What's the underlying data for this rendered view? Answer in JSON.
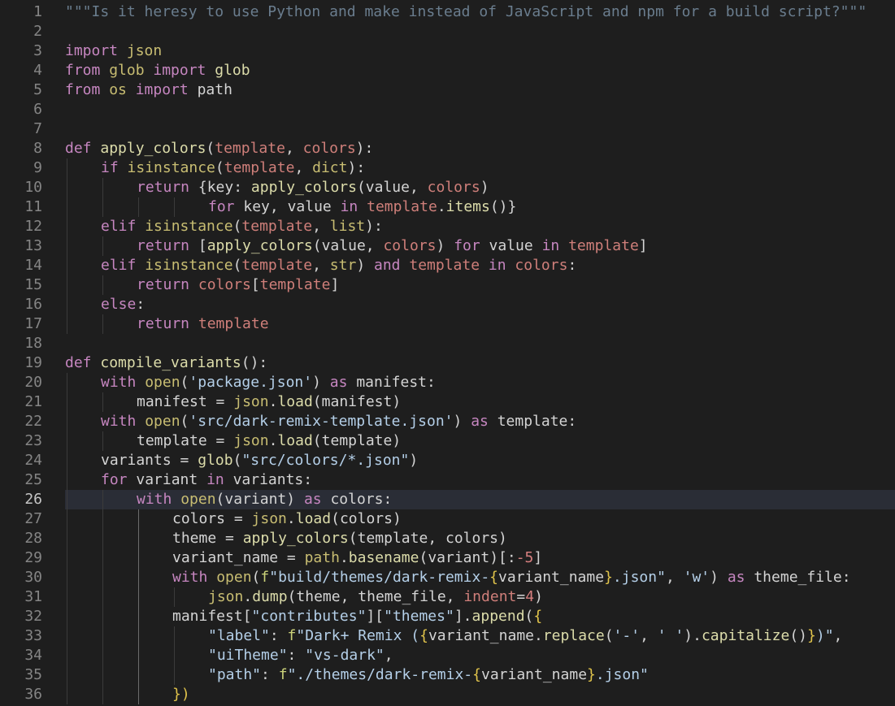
{
  "editor": {
    "active_line": 26,
    "lines": [
      {
        "n": "1",
        "indent": 0,
        "tokens": [
          [
            "\"\"\"Is it heresy to use Python and make instead of JavaScript and npm for a build script?\"\"\"",
            "comment"
          ]
        ]
      },
      {
        "n": "2",
        "indent": 0,
        "tokens": []
      },
      {
        "n": "3",
        "indent": 0,
        "tokens": [
          [
            "import ",
            "keyword"
          ],
          [
            "json",
            "builtin"
          ]
        ]
      },
      {
        "n": "4",
        "indent": 0,
        "tokens": [
          [
            "from ",
            "keyword"
          ],
          [
            "glob ",
            "builtin"
          ],
          [
            "import ",
            "keyword"
          ],
          [
            "glob",
            "function"
          ]
        ]
      },
      {
        "n": "5",
        "indent": 0,
        "tokens": [
          [
            "from ",
            "keyword"
          ],
          [
            "os ",
            "builtin"
          ],
          [
            "import ",
            "keyword"
          ],
          [
            "path",
            "default"
          ]
        ]
      },
      {
        "n": "6",
        "indent": 0,
        "tokens": []
      },
      {
        "n": "7",
        "indent": 0,
        "tokens": []
      },
      {
        "n": "8",
        "indent": 0,
        "tokens": [
          [
            "def ",
            "keyword"
          ],
          [
            "apply_colors",
            "function"
          ],
          [
            "(",
            "paren"
          ],
          [
            "template",
            "param"
          ],
          [
            ", ",
            "default"
          ],
          [
            "colors",
            "param"
          ],
          [
            "):",
            "paren"
          ]
        ]
      },
      {
        "n": "9",
        "indent": 1,
        "tokens": [
          [
            "if ",
            "keyword"
          ],
          [
            "isinstance",
            "builtin"
          ],
          [
            "(",
            "paren"
          ],
          [
            "template",
            "param"
          ],
          [
            ", ",
            "default"
          ],
          [
            "dict",
            "builtin"
          ],
          [
            "):",
            "paren"
          ]
        ]
      },
      {
        "n": "10",
        "indent": 2,
        "tokens": [
          [
            "return ",
            "keyword"
          ],
          [
            "{",
            "paren"
          ],
          [
            "key",
            "default"
          ],
          [
            ": ",
            "default"
          ],
          [
            "apply_colors",
            "function"
          ],
          [
            "(",
            "paren"
          ],
          [
            "value",
            "default"
          ],
          [
            ", ",
            "default"
          ],
          [
            "colors",
            "param"
          ],
          [
            ")",
            "paren"
          ]
        ]
      },
      {
        "n": "11",
        "indent": 4,
        "tokens": [
          [
            "for ",
            "keyword"
          ],
          [
            "key",
            "default"
          ],
          [
            ", ",
            "default"
          ],
          [
            "value ",
            "default"
          ],
          [
            "in ",
            "keyword"
          ],
          [
            "template",
            "param"
          ],
          [
            ".",
            "default"
          ],
          [
            "items",
            "function"
          ],
          [
            "()}",
            "paren"
          ]
        ]
      },
      {
        "n": "12",
        "indent": 1,
        "tokens": [
          [
            "elif ",
            "keyword"
          ],
          [
            "isinstance",
            "builtin"
          ],
          [
            "(",
            "paren"
          ],
          [
            "template",
            "param"
          ],
          [
            ", ",
            "default"
          ],
          [
            "list",
            "builtin"
          ],
          [
            "):",
            "paren"
          ]
        ]
      },
      {
        "n": "13",
        "indent": 2,
        "tokens": [
          [
            "return ",
            "keyword"
          ],
          [
            "[",
            "paren"
          ],
          [
            "apply_colors",
            "function"
          ],
          [
            "(",
            "paren"
          ],
          [
            "value",
            "default"
          ],
          [
            ", ",
            "default"
          ],
          [
            "colors",
            "param"
          ],
          [
            ") ",
            "paren"
          ],
          [
            "for ",
            "keyword"
          ],
          [
            "value ",
            "default"
          ],
          [
            "in ",
            "keyword"
          ],
          [
            "template",
            "param"
          ],
          [
            "]",
            "paren"
          ]
        ]
      },
      {
        "n": "14",
        "indent": 1,
        "tokens": [
          [
            "elif ",
            "keyword"
          ],
          [
            "isinstance",
            "builtin"
          ],
          [
            "(",
            "paren"
          ],
          [
            "template",
            "param"
          ],
          [
            ", ",
            "default"
          ],
          [
            "str",
            "builtin"
          ],
          [
            ") ",
            "paren"
          ],
          [
            "and ",
            "keyword"
          ],
          [
            "template ",
            "param"
          ],
          [
            "in ",
            "keyword"
          ],
          [
            "colors",
            "param"
          ],
          [
            ":",
            "default"
          ]
        ]
      },
      {
        "n": "15",
        "indent": 2,
        "tokens": [
          [
            "return ",
            "keyword"
          ],
          [
            "colors",
            "param"
          ],
          [
            "[",
            "paren"
          ],
          [
            "template",
            "param"
          ],
          [
            "]",
            "paren"
          ]
        ]
      },
      {
        "n": "16",
        "indent": 1,
        "tokens": [
          [
            "else",
            "keyword"
          ],
          [
            ":",
            "default"
          ]
        ]
      },
      {
        "n": "17",
        "indent": 2,
        "tokens": [
          [
            "return ",
            "keyword"
          ],
          [
            "template",
            "param"
          ]
        ]
      },
      {
        "n": "18",
        "indent": 0,
        "tokens": []
      },
      {
        "n": "19",
        "indent": 0,
        "tokens": [
          [
            "def ",
            "keyword"
          ],
          [
            "compile_variants",
            "function"
          ],
          [
            "():",
            "paren"
          ]
        ]
      },
      {
        "n": "20",
        "indent": 1,
        "tokens": [
          [
            "with ",
            "keyword"
          ],
          [
            "open",
            "builtin"
          ],
          [
            "(",
            "paren"
          ],
          [
            "'package.json'",
            "string"
          ],
          [
            ") ",
            "paren"
          ],
          [
            "as ",
            "keyword"
          ],
          [
            "manifest",
            "default"
          ],
          [
            ":",
            "default"
          ]
        ]
      },
      {
        "n": "21",
        "indent": 2,
        "tokens": [
          [
            "manifest ",
            "default"
          ],
          [
            "= ",
            "default"
          ],
          [
            "json",
            "builtin"
          ],
          [
            ".",
            "default"
          ],
          [
            "load",
            "function"
          ],
          [
            "(",
            "paren"
          ],
          [
            "manifest",
            "default"
          ],
          [
            ")",
            "paren"
          ]
        ]
      },
      {
        "n": "22",
        "indent": 1,
        "tokens": [
          [
            "with ",
            "keyword"
          ],
          [
            "open",
            "builtin"
          ],
          [
            "(",
            "paren"
          ],
          [
            "'src/dark-remix-template.json'",
            "string"
          ],
          [
            ") ",
            "paren"
          ],
          [
            "as ",
            "keyword"
          ],
          [
            "template",
            "default"
          ],
          [
            ":",
            "default"
          ]
        ]
      },
      {
        "n": "23",
        "indent": 2,
        "tokens": [
          [
            "template ",
            "default"
          ],
          [
            "= ",
            "default"
          ],
          [
            "json",
            "builtin"
          ],
          [
            ".",
            "default"
          ],
          [
            "load",
            "function"
          ],
          [
            "(",
            "paren"
          ],
          [
            "template",
            "default"
          ],
          [
            ")",
            "paren"
          ]
        ]
      },
      {
        "n": "24",
        "indent": 1,
        "tokens": [
          [
            "variants ",
            "default"
          ],
          [
            "= ",
            "default"
          ],
          [
            "glob",
            "function"
          ],
          [
            "(",
            "paren"
          ],
          [
            "\"src/colors/*.json\"",
            "string"
          ],
          [
            ")",
            "paren"
          ]
        ]
      },
      {
        "n": "25",
        "indent": 1,
        "tokens": [
          [
            "for ",
            "keyword"
          ],
          [
            "variant ",
            "default"
          ],
          [
            "in ",
            "keyword"
          ],
          [
            "variants",
            "default"
          ],
          [
            ":",
            "default"
          ]
        ]
      },
      {
        "n": "26",
        "indent": 2,
        "tokens": [
          [
            "with ",
            "keyword"
          ],
          [
            "open",
            "builtin"
          ],
          [
            "(",
            "paren"
          ],
          [
            "variant",
            "default"
          ],
          [
            ") ",
            "paren"
          ],
          [
            "as ",
            "keyword"
          ],
          [
            "colors",
            "default"
          ],
          [
            ":",
            "default"
          ]
        ]
      },
      {
        "n": "27",
        "indent": 3,
        "tokens": [
          [
            "colors ",
            "default"
          ],
          [
            "= ",
            "default"
          ],
          [
            "json",
            "builtin"
          ],
          [
            ".",
            "default"
          ],
          [
            "load",
            "function"
          ],
          [
            "(",
            "paren"
          ],
          [
            "colors",
            "default"
          ],
          [
            ")",
            "paren"
          ]
        ]
      },
      {
        "n": "28",
        "indent": 3,
        "tokens": [
          [
            "theme ",
            "default"
          ],
          [
            "= ",
            "default"
          ],
          [
            "apply_colors",
            "function"
          ],
          [
            "(",
            "paren"
          ],
          [
            "template",
            "default"
          ],
          [
            ", ",
            "default"
          ],
          [
            "colors",
            "default"
          ],
          [
            ")",
            "paren"
          ]
        ]
      },
      {
        "n": "29",
        "indent": 3,
        "tokens": [
          [
            "variant_name ",
            "default"
          ],
          [
            "= ",
            "default"
          ],
          [
            "path",
            "builtin"
          ],
          [
            ".",
            "default"
          ],
          [
            "basename",
            "function"
          ],
          [
            "(",
            "paren"
          ],
          [
            "variant",
            "default"
          ],
          [
            ")",
            "paren"
          ],
          [
            "[:",
            "paren"
          ],
          [
            "-5",
            "number"
          ],
          [
            "]",
            "paren"
          ]
        ]
      },
      {
        "n": "30",
        "indent": 3,
        "tokens": [
          [
            "with ",
            "keyword"
          ],
          [
            "open",
            "builtin"
          ],
          [
            "(",
            "paren"
          ],
          [
            "f",
            "prefix"
          ],
          [
            "\"build/themes/dark-remix-",
            "string"
          ],
          [
            "{",
            "brace"
          ],
          [
            "variant_name",
            "default"
          ],
          [
            "}",
            "brace"
          ],
          [
            ".json\"",
            "string"
          ],
          [
            ", ",
            "default"
          ],
          [
            "'w'",
            "string"
          ],
          [
            ") ",
            "paren"
          ],
          [
            "as ",
            "keyword"
          ],
          [
            "theme_file",
            "default"
          ],
          [
            ":",
            "default"
          ]
        ]
      },
      {
        "n": "31",
        "indent": 4,
        "tokens": [
          [
            "json",
            "builtin"
          ],
          [
            ".",
            "default"
          ],
          [
            "dump",
            "function"
          ],
          [
            "(",
            "paren"
          ],
          [
            "theme",
            "default"
          ],
          [
            ", ",
            "default"
          ],
          [
            "theme_file",
            "default"
          ],
          [
            ", ",
            "default"
          ],
          [
            "indent",
            "param"
          ],
          [
            "=",
            "default"
          ],
          [
            "4",
            "number"
          ],
          [
            ")",
            "paren"
          ]
        ]
      },
      {
        "n": "32",
        "indent": 3,
        "tokens": [
          [
            "manifest",
            "default"
          ],
          [
            "[",
            "paren"
          ],
          [
            "\"contributes\"",
            "string"
          ],
          [
            "][",
            "paren"
          ],
          [
            "\"themes\"",
            "string"
          ],
          [
            "].",
            "paren"
          ],
          [
            "append",
            "function"
          ],
          [
            "(",
            "paren"
          ],
          [
            "{",
            "brace"
          ]
        ]
      },
      {
        "n": "33",
        "indent": 4,
        "tokens": [
          [
            "\"label\"",
            "string"
          ],
          [
            ": ",
            "default"
          ],
          [
            "f",
            "prefix"
          ],
          [
            "\"Dark+ Remix (",
            "string"
          ],
          [
            "{",
            "brace"
          ],
          [
            "variant_name",
            "default"
          ],
          [
            ".",
            "default"
          ],
          [
            "replace",
            "function"
          ],
          [
            "(",
            "paren"
          ],
          [
            "'-'",
            "string"
          ],
          [
            ", ",
            "default"
          ],
          [
            "' '",
            "string"
          ],
          [
            ")",
            "paren"
          ],
          [
            ".",
            "default"
          ],
          [
            "capitalize",
            "function"
          ],
          [
            "()",
            "paren"
          ],
          [
            "}",
            "brace"
          ],
          [
            ")\"",
            "string"
          ],
          [
            ",",
            "default"
          ]
        ]
      },
      {
        "n": "34",
        "indent": 4,
        "tokens": [
          [
            "\"uiTheme\"",
            "string"
          ],
          [
            ": ",
            "default"
          ],
          [
            "\"vs-dark\"",
            "string"
          ],
          [
            ",",
            "default"
          ]
        ]
      },
      {
        "n": "35",
        "indent": 4,
        "tokens": [
          [
            "\"path\"",
            "string"
          ],
          [
            ": ",
            "default"
          ],
          [
            "f",
            "prefix"
          ],
          [
            "\"./themes/dark-remix-",
            "string"
          ],
          [
            "{",
            "brace"
          ],
          [
            "variant_name",
            "default"
          ],
          [
            "}",
            "brace"
          ],
          [
            ".json\"",
            "string"
          ]
        ]
      },
      {
        "n": "36",
        "indent": 3,
        "tokens": [
          [
            "})",
            "brace"
          ]
        ]
      }
    ]
  }
}
